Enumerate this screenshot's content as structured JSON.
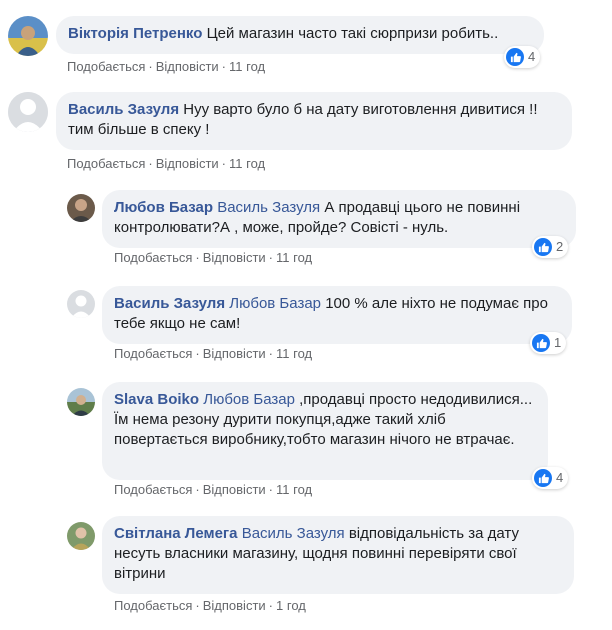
{
  "comments": [
    {
      "author": "Вікторія Петренко",
      "text": "Цей магазин часто такі сюрпризи робить..",
      "like_label": "Подобається",
      "reply_label": "Відповісти",
      "time": "11 год",
      "reactions": "4"
    },
    {
      "author": "Василь Зазуля",
      "text": "Нуу варто було б на дату виготовлення дивитися !!тим більше в спеку !",
      "like_label": "Подобається",
      "reply_label": "Відповісти",
      "time": "11 год"
    },
    {
      "author": "Любов Базар",
      "mention": "Василь Зазуля",
      "text": "А продавці цього не повинні контролювати?А , може, пройде? Совісті - нуль.",
      "like_label": "Подобається",
      "reply_label": "Відповісти",
      "time": "11 год",
      "reactions": "2"
    },
    {
      "author": "Василь Зазуля",
      "mention": "Любов Базар",
      "text": "100 % але ніхто не подумає про тебе якщо не сам!",
      "like_label": "Подобається",
      "reply_label": "Відповісти",
      "time": "11 год",
      "reactions": "1"
    },
    {
      "author": "Slava Boiko",
      "mention": "Любов Базар",
      "text": ",продавці просто недодивилися...",
      "text2": "Їм нема резону дурити покупця,адже такий хліб повертається виробнику,тобто магазин нічого не втрачає.",
      "like_label": "Подобається",
      "reply_label": "Відповісти",
      "time": "11 год",
      "reactions": "4"
    },
    {
      "author": "Світлана Лемега",
      "mention": "Василь Зазуля",
      "text": "відповідальність за дату несуть власники магазину, щодня повинні перевіряти свої вітрини",
      "like_label": "Подобається",
      "reply_label": "Відповісти",
      "time": "1 год"
    }
  ],
  "separator": "·",
  "colors": {
    "author": "#385898",
    "bubble": "#f0f2f5",
    "like": "#1877f2",
    "meta": "#65676b"
  }
}
